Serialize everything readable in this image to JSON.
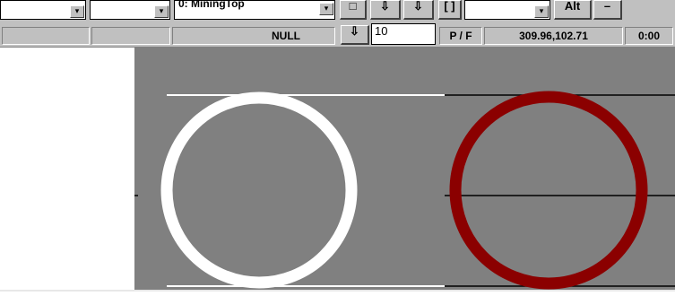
{
  "toolbar": {
    "layer_combo_value": "0: MiningTop",
    "arrow_label": "▾",
    "btn_square": "□",
    "btn_down1": "⇩",
    "btn_down2": "⇩",
    "btn_bracket": "[ ]",
    "btn_alt": "Alt",
    "btn_minus": "–"
  },
  "statusbar": {
    "null_label": "NULL",
    "down_icon_label": "⇩",
    "value_input": "10",
    "pf_label": "P / F",
    "coordinates": "309.96,102.71",
    "time": "0:00"
  },
  "canvas": {
    "background_color": "#808080",
    "white_circle_color": "#ffffff",
    "red_circle_color": "#8b0000",
    "line_color_white": "#ffffff",
    "line_color_black": "#000000"
  }
}
